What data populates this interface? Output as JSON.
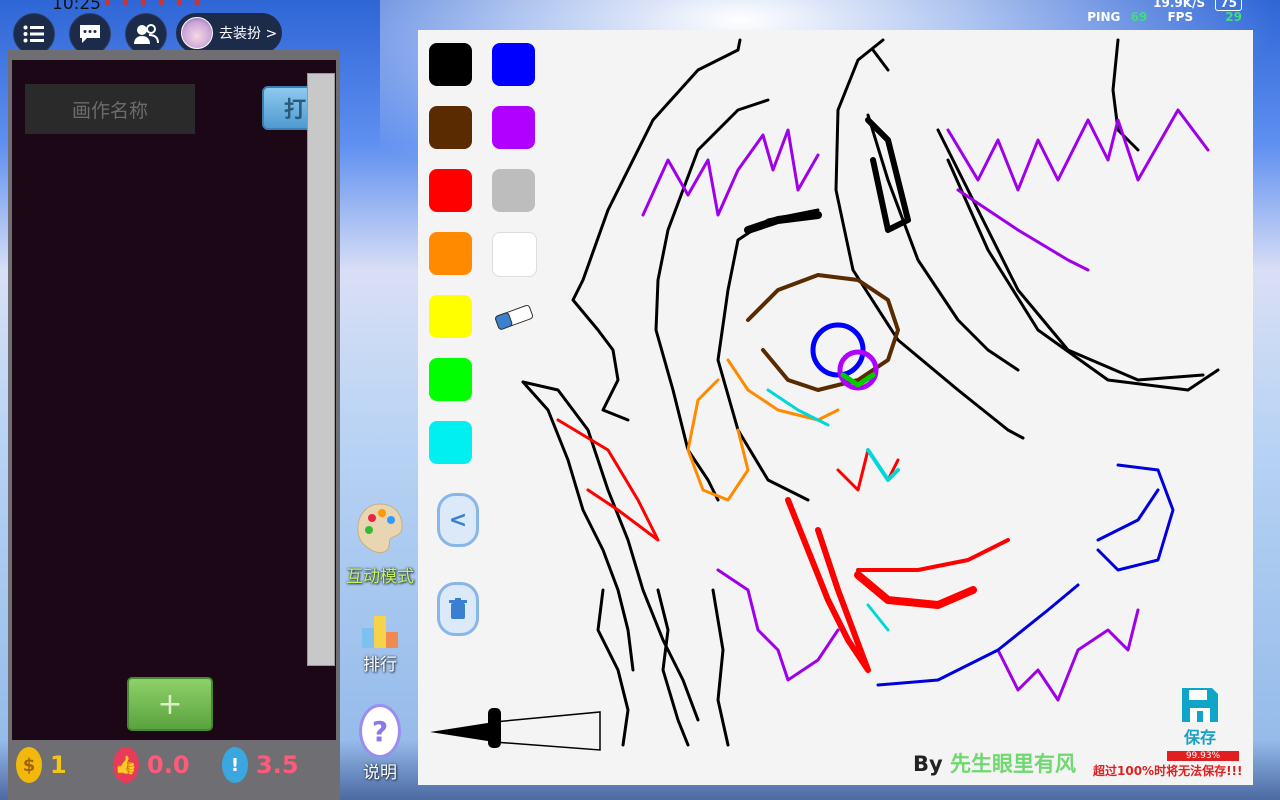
{
  "status_bar": {
    "time": "10:25",
    "speed": "19.9K/S",
    "ping_label": "PING",
    "ping_value": "69",
    "fps_label": "FPS",
    "fps_value": "29",
    "battery": "75"
  },
  "top_bar": {
    "dressup_label": "去装扮 >"
  },
  "left_panel": {
    "name_placeholder": "画作名称",
    "open_button": "打",
    "add_button": "+"
  },
  "stats": {
    "coins": "1",
    "likes": "0.0",
    "rating": "3.5"
  },
  "side_tools": {
    "interactive_mode": "互动模式",
    "ranking": "排行",
    "help": "说明"
  },
  "palette": {
    "colors": [
      "#000000",
      "#0000ff",
      "#5a2a00",
      "#b000ff",
      "#ff0000",
      "#bdbdbd",
      "#ff8a00",
      "#ffffff",
      "#ffff00",
      "#00ff00",
      "#00f0f0"
    ],
    "tools": [
      "eraser-icon",
      "back-icon",
      "trash-icon"
    ]
  },
  "canvas": {
    "credit_prefix": "By",
    "credit_author": "先生眼里有风"
  },
  "save": {
    "label": "保存",
    "progress_text": "99.93%",
    "progress_fraction": 0.9993,
    "warning": "超过100%时将无法保存!!!"
  }
}
